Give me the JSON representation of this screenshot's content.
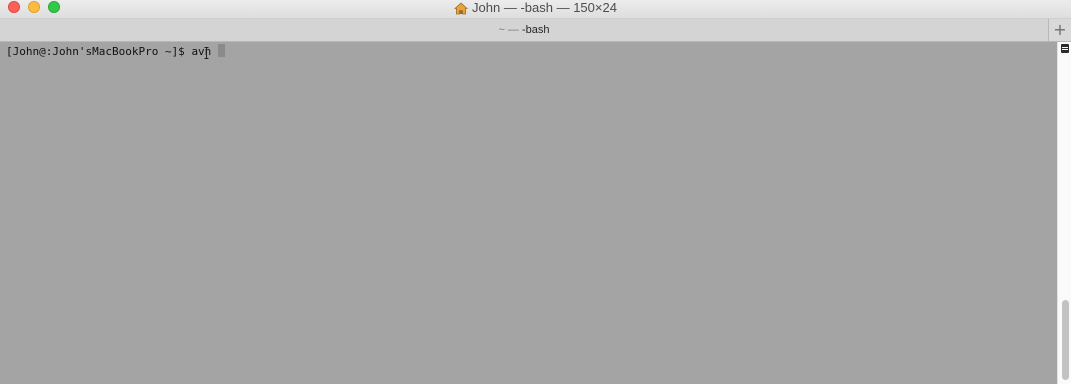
{
  "window": {
    "title": "John — -bash — 150×24",
    "title_icon": "home-icon"
  },
  "tab": {
    "label_prefix": "~ —",
    "label_main": "-bash"
  },
  "toolbar": {
    "new_tab_label": "+"
  },
  "terminal": {
    "prompt": "[John@:John'sMacBookPro ~]$ ",
    "command": "avn"
  },
  "colors": {
    "terminal_background": "#a4a4a4",
    "close": "#fc605b",
    "minimize": "#fdbc40",
    "maximize": "#34c84a"
  }
}
